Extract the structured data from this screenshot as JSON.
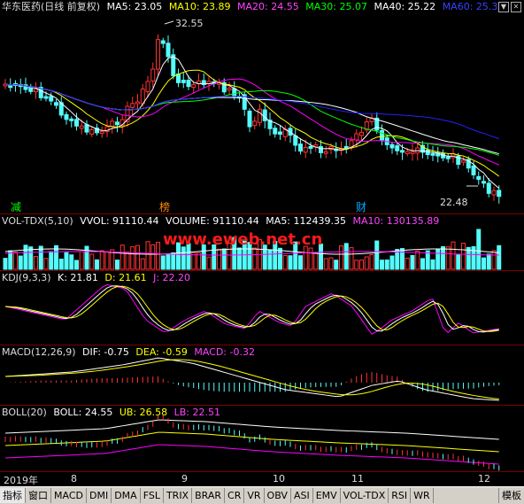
{
  "main": {
    "stock": "华东医药(日线 前复权)",
    "ma": [
      {
        "label": "MA5: 23.05",
        "color": "#ffffff"
      },
      {
        "label": "MA10: 23.89",
        "color": "#ffff00"
      },
      {
        "label": "MA20: 24.55",
        "color": "#ff00ff"
      },
      {
        "label": "MA30: 25.07",
        "color": "#00ff00"
      },
      {
        "label": "MA40: 25.22",
        "color": "#ffffff"
      },
      {
        "label": "MA60: 25.3",
        "color": "#2222ff"
      }
    ],
    "high_label": "32.55",
    "low_label": "22.48",
    "marks": [
      {
        "text": "减",
        "color": "#00ff00"
      },
      {
        "text": "榜",
        "color": "#ff8800"
      },
      {
        "text": "财",
        "color": "#00aaff"
      }
    ]
  },
  "vol": {
    "name": "VOL-TDX(5,10)",
    "vvol": "VVOL: 91110.44",
    "volume": "VOLUME: 91110.44",
    "ma5": "MA5: 112439.35",
    "ma10": "MA10: 130135.89",
    "watermark": "www.eweb.net.cn"
  },
  "kdj": {
    "name": "KDJ(9,3,3)",
    "k": "K: 21.81",
    "d": "D: 21.61",
    "j": "J: 22.20"
  },
  "macd": {
    "name": "MACD(12,26,9)",
    "dif": "DIF: -0.75",
    "dea": "DEA: -0.59",
    "macd": "MACD: -0.32"
  },
  "boll": {
    "name": "BOLL(20)",
    "boll": "BOLL: 24.55",
    "ub": "UB: 26.58",
    "lb": "LB: 22.51"
  },
  "dates": [
    "2019年",
    "8",
    "9",
    "10",
    "11",
    "12"
  ],
  "toolbar": [
    "指标",
    "窗口",
    "MACD",
    "DMI",
    "DMA",
    "FSL",
    "TRIX",
    "BRAR",
    "CR",
    "VR",
    "OBV",
    "ASI",
    "EMV",
    "VOL-TDX",
    "RSI",
    "WR"
  ],
  "toolbar_right": "模板",
  "colors": {
    "up": "#ff3232",
    "down": "#54fcfc",
    "grid": "#7a0000"
  }
}
